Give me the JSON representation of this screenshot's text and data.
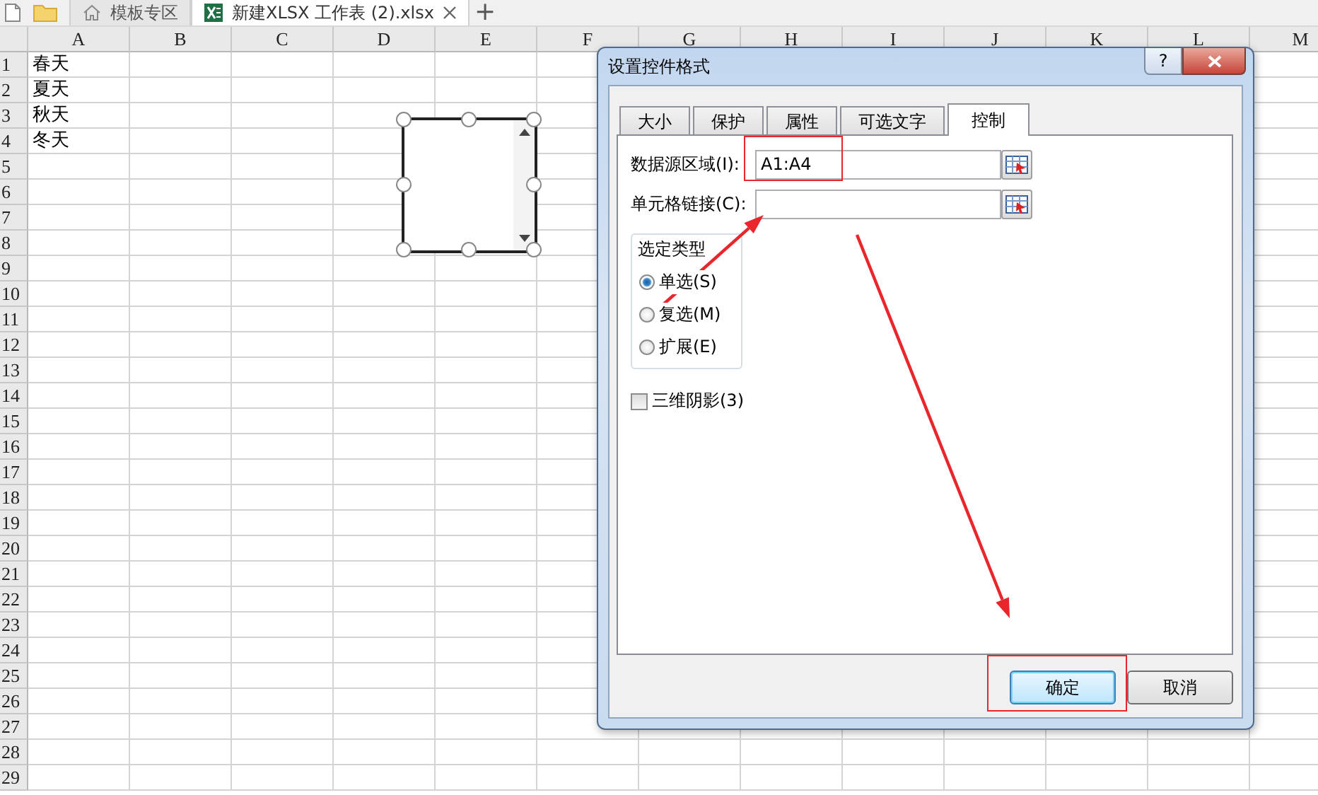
{
  "app_tabs": [
    {
      "label": "模板专区",
      "kind": "home",
      "selected": false
    },
    {
      "label": "新建XLSX 工作表 (2).xlsx",
      "kind": "spreadsheet",
      "selected": true
    }
  ],
  "new_tab": "+",
  "sheet": {
    "columns": [
      "A",
      "B",
      "C",
      "D",
      "E",
      "F",
      "G",
      "H",
      "I",
      "J",
      "K",
      "L",
      "M"
    ],
    "rows": [
      {
        "header": "1",
        "cells": [
          "春天"
        ]
      },
      {
        "header": "2",
        "cells": [
          "夏天"
        ]
      },
      {
        "header": "3",
        "cells": [
          "秋天"
        ]
      },
      {
        "header": "4",
        "cells": [
          "冬天"
        ]
      },
      {
        "header": "5"
      },
      {
        "header": "6"
      },
      {
        "header": "7"
      },
      {
        "header": "8"
      },
      {
        "header": "9"
      },
      {
        "header": "10"
      },
      {
        "header": "11"
      },
      {
        "header": "12"
      },
      {
        "header": "13"
      },
      {
        "header": "14"
      },
      {
        "header": "15"
      },
      {
        "header": "16"
      },
      {
        "header": "17"
      },
      {
        "header": "18"
      },
      {
        "header": "19"
      },
      {
        "header": "20"
      },
      {
        "header": "21"
      },
      {
        "header": "22"
      },
      {
        "header": "23"
      },
      {
        "header": "24"
      },
      {
        "header": "25"
      },
      {
        "header": "26"
      },
      {
        "header": "27"
      },
      {
        "header": "28"
      },
      {
        "header": "29"
      }
    ],
    "list_box_control": {
      "selected": true
    }
  },
  "dialog": {
    "title": "设置控件格式",
    "help": "?",
    "tabs": [
      {
        "label": "大小",
        "selected": false
      },
      {
        "label": "保护",
        "selected": false
      },
      {
        "label": "属性",
        "selected": false
      },
      {
        "label": "可选文字",
        "selected": false
      },
      {
        "label": "控制",
        "selected": true
      }
    ],
    "fields": [
      {
        "label": "数据源区域(I):",
        "value": "A1:A4",
        "highlighted": true
      },
      {
        "label": "单元格链接(C):",
        "highlighted": false
      }
    ],
    "selection_group": {
      "title": "选定类型",
      "options": [
        {
          "label": "单选(S)",
          "selected": true
        },
        {
          "label": "复选(M)",
          "selected": false
        },
        {
          "label": "扩展(E)",
          "selected": false
        }
      ]
    },
    "checkbox": {
      "label": "三维阴影(3)",
      "checked": false
    },
    "buttons": [
      {
        "label": "确定",
        "default": true,
        "highlighted": true
      },
      {
        "label": "取消",
        "default": false,
        "highlighted": false
      }
    ]
  }
}
